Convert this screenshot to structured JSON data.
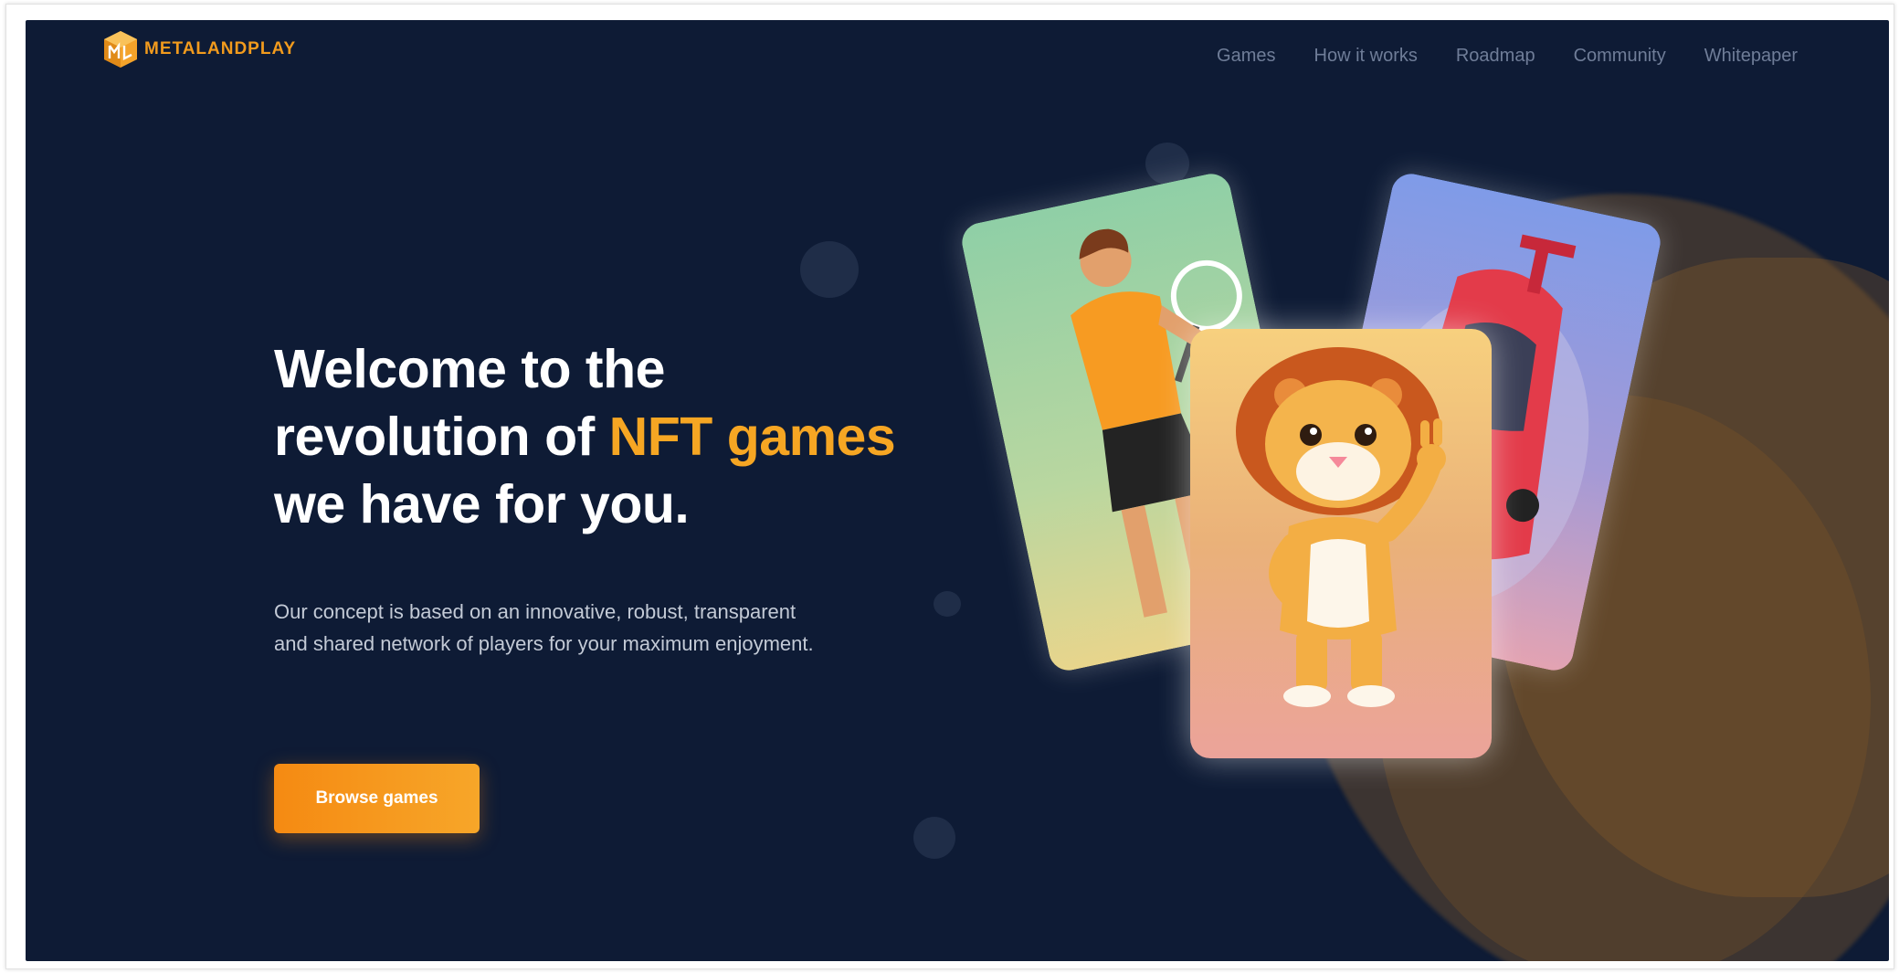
{
  "brand": {
    "name": "METALANDPLAY",
    "logo_icon": "cube-logo-icon",
    "accent_color": "#f6a623",
    "background_color": "#0e1b35"
  },
  "nav": {
    "links": [
      {
        "label": "Games"
      },
      {
        "label": "How it works"
      },
      {
        "label": "Roadmap"
      },
      {
        "label": "Community"
      },
      {
        "label": "Whitepaper"
      }
    ]
  },
  "hero": {
    "title_line1": "Welcome to the",
    "title_line2_prefix": "revolution of ",
    "title_line2_accent": "NFT games",
    "title_line3": "we have for you.",
    "description": "Our concept is based on an innovative, robust, transparent and shared network of players for your maximum enjoyment.",
    "cta_label": "Browse games"
  },
  "cards": [
    {
      "illustration": "tennis-player-illustration"
    },
    {
      "illustration": "lion-mascot-illustration"
    },
    {
      "illustration": "race-car-illustration"
    }
  ]
}
